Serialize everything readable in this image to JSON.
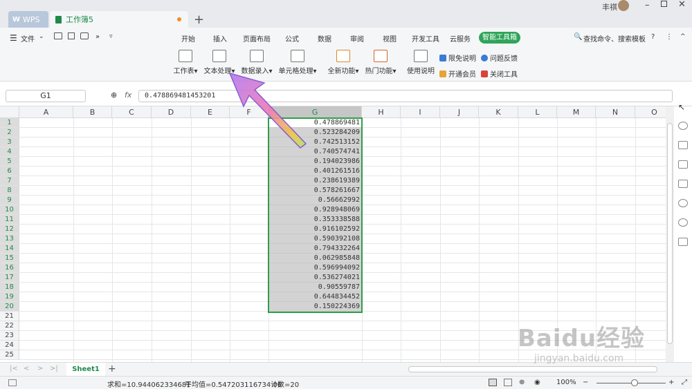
{
  "titlebar": {
    "tabs": [
      {
        "label": "WPS"
      },
      {
        "label": "工作簿5"
      }
    ],
    "user": "丰祺"
  },
  "menubar": {
    "file": "文件",
    "items": [
      "开始",
      "插入",
      "页面布局",
      "公式",
      "数据",
      "审阅",
      "视图",
      "开发工具",
      "云服务"
    ],
    "active": "智能工具箱",
    "search": "查找命令、搜索模板"
  },
  "ribbon": {
    "buttons": [
      "工作表",
      "文本处理",
      "数据录入",
      "单元格处理",
      "全新功能",
      "热门功能",
      "使用说明"
    ],
    "small": [
      "限免说明",
      "问题反馈",
      "开通会员",
      "关闭工具"
    ]
  },
  "formula": {
    "namebox": "G1",
    "fx": "fx",
    "value": "0.478869481453201"
  },
  "grid": {
    "columns": [
      "A",
      "B",
      "C",
      "D",
      "E",
      "F",
      "G",
      "H",
      "I",
      "J",
      "K",
      "L",
      "M",
      "N",
      "O"
    ],
    "rows": [
      "1",
      "2",
      "3",
      "4",
      "5",
      "6",
      "7",
      "8",
      "9",
      "10",
      "11",
      "12",
      "13",
      "14",
      "15",
      "16",
      "17",
      "18",
      "19",
      "20",
      "21",
      "22",
      "23",
      "24",
      "25"
    ],
    "g_values": [
      "0.478869481",
      "0.523284209",
      "0.742513152",
      "0.740574741",
      "0.194023986",
      "0.401261516",
      "0.238619389",
      "0.578261667",
      "0.56662992",
      "0.928948069",
      "0.353338588",
      "0.916102592",
      "0.590392108",
      "0.794332264",
      "0.062985848",
      "0.596994092",
      "0.536274021",
      "0.90559787",
      "0.644834452",
      "0.150224369"
    ]
  },
  "sheet": {
    "name": "Sheet1",
    "add": "+"
  },
  "status": {
    "sum": "求和=10.944062334681",
    "avg": "平均值=0.547203116734 06",
    "count": "计数=20",
    "zoom": "100%"
  },
  "watermark": {
    "line1": "Baidu经验",
    "line2": "jingyan.baidu.com"
  },
  "colors": {
    "accent": "#2fa55a",
    "selection": "#2e9e4a",
    "selFill": "#d3d3d3"
  }
}
